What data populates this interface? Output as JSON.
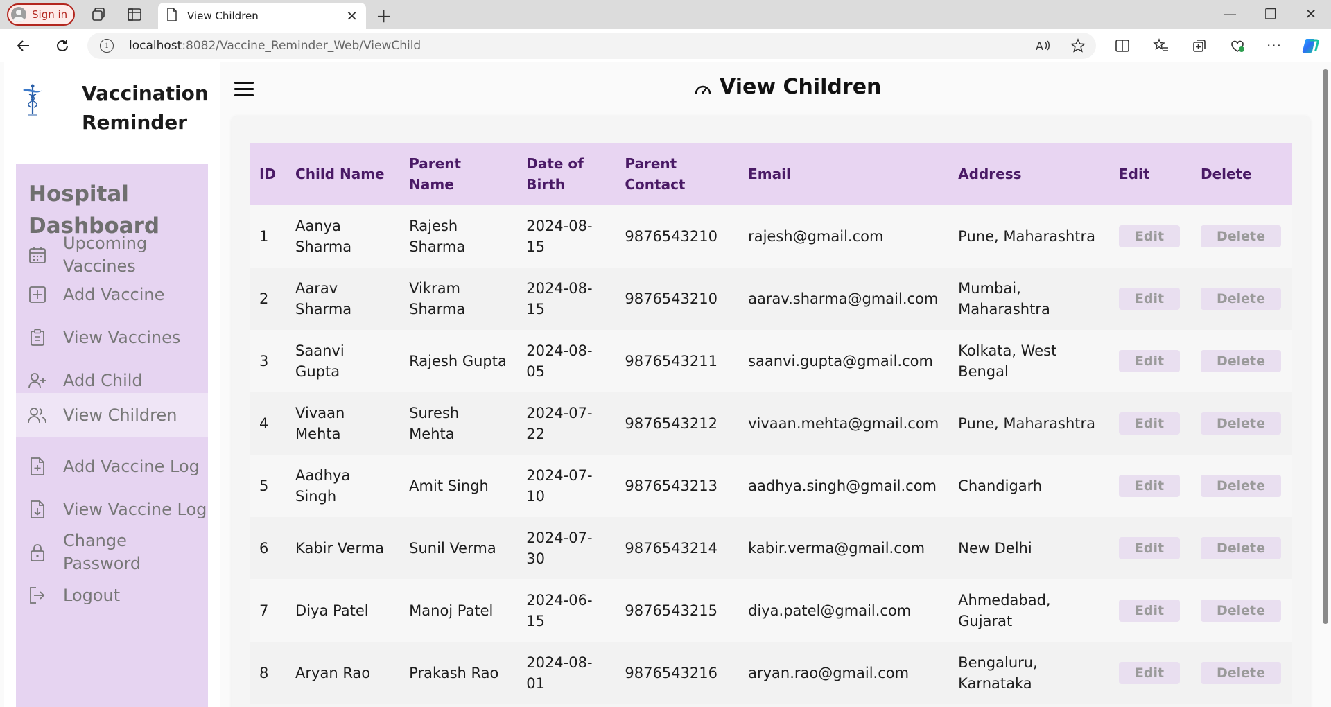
{
  "browser": {
    "signin_label": "Sign in",
    "tab_title": "View Children",
    "url_host": "localhost",
    "url_rest": ":8082/Vaccine_Reminder_Web/ViewChild"
  },
  "brand": {
    "line1": "Vaccination",
    "line2": "Reminder"
  },
  "sidebar": {
    "title_line1": "Hospital",
    "title_line2": "Dashboard",
    "items": [
      {
        "label": "Upcoming Vaccines",
        "icon": "calendar-icon"
      },
      {
        "label": "Add Vaccine",
        "icon": "plus-square-icon"
      },
      {
        "label": "View Vaccines",
        "icon": "clipboard-icon"
      },
      {
        "label": "Add Child",
        "icon": "user-plus-icon"
      },
      {
        "label": "View Children",
        "icon": "users-icon",
        "active": true
      },
      {
        "label": "Add Vaccine Log",
        "icon": "file-plus-icon"
      },
      {
        "label": "View Vaccine Log",
        "icon": "file-down-icon"
      },
      {
        "label": "Change Password",
        "icon": "lock-icon"
      },
      {
        "label": "Logout",
        "icon": "logout-icon"
      }
    ]
  },
  "header": {
    "title": "View Children"
  },
  "table": {
    "columns": [
      "ID",
      "Child Name",
      "Parent Name",
      "Date of Birth",
      "Parent Contact",
      "Email",
      "Address",
      "Edit",
      "Delete"
    ],
    "edit_label": "Edit",
    "delete_label": "Delete",
    "rows": [
      {
        "id": "1",
        "child": "Aanya Sharma",
        "parent": "Rajesh Sharma",
        "dob": "2024-08-15",
        "contact": "9876543210",
        "email": "rajesh@gmail.com",
        "address": "Pune, Maharashtra"
      },
      {
        "id": "2",
        "child": "Aarav Sharma",
        "parent": "Vikram Sharma",
        "dob": "2024-08-15",
        "contact": "9876543210",
        "email": "aarav.sharma@gmail.com",
        "address": "Mumbai, Maharashtra"
      },
      {
        "id": "3",
        "child": "Saanvi Gupta",
        "parent": "Rajesh Gupta",
        "dob": "2024-08-05",
        "contact": "9876543211",
        "email": "saanvi.gupta@gmail.com",
        "address": "Kolkata, West Bengal"
      },
      {
        "id": "4",
        "child": "Vivaan Mehta",
        "parent": "Suresh Mehta",
        "dob": "2024-07-22",
        "contact": "9876543212",
        "email": "vivaan.mehta@gmail.com",
        "address": "Pune, Maharashtra"
      },
      {
        "id": "5",
        "child": "Aadhya Singh",
        "parent": "Amit Singh",
        "dob": "2024-07-10",
        "contact": "9876543213",
        "email": "aadhya.singh@gmail.com",
        "address": "Chandigarh"
      },
      {
        "id": "6",
        "child": "Kabir Verma",
        "parent": "Sunil Verma",
        "dob": "2024-07-30",
        "contact": "9876543214",
        "email": "kabir.verma@gmail.com",
        "address": "New Delhi"
      },
      {
        "id": "7",
        "child": "Diya Patel",
        "parent": "Manoj Patel",
        "dob": "2024-06-15",
        "contact": "9876543215",
        "email": "diya.patel@gmail.com",
        "address": "Ahmedabad, Gujarat"
      },
      {
        "id": "8",
        "child": "Aryan Rao",
        "parent": "Prakash Rao",
        "dob": "2024-08-01",
        "contact": "9876543216",
        "email": "aryan.rao@gmail.com",
        "address": "Bengaluru, Karnataka"
      }
    ]
  }
}
